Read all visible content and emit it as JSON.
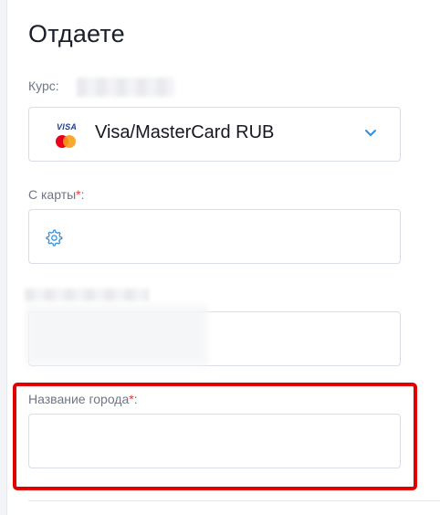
{
  "section": {
    "title": "Отдаете"
  },
  "rate": {
    "label": "Курс:"
  },
  "payment_select": {
    "logo_text": "VISA",
    "value": "Visa/MasterCard RUB",
    "icons": [
      "visa-mastercard-icon",
      "chevron-down-icon"
    ]
  },
  "card_field": {
    "label": "С карты",
    "required_mark": "*",
    "suffix": ":",
    "icon": "gear-icon"
  },
  "city_field": {
    "label": "Название города",
    "required_mark": "*",
    "suffix": ":"
  },
  "colors": {
    "accent": "#2d8fe0",
    "required": "#e53935",
    "highlight": "#e00000"
  }
}
